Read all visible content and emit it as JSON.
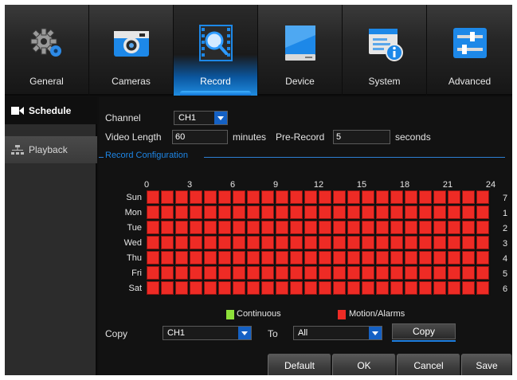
{
  "tabs": [
    {
      "label": "General",
      "icon": "gear-icon",
      "active": false
    },
    {
      "label": "Cameras",
      "icon": "camera-icon",
      "active": false
    },
    {
      "label": "Record",
      "icon": "record-search-icon",
      "active": true
    },
    {
      "label": "Device",
      "icon": "hard-drive-icon",
      "active": false
    },
    {
      "label": "System",
      "icon": "system-info-icon",
      "active": false
    },
    {
      "label": "Advanced",
      "icon": "sliders-icon",
      "active": false
    }
  ],
  "sidebar": {
    "items": [
      {
        "label": "Schedule",
        "icon": "video-camera-icon",
        "active": true
      },
      {
        "label": "Playback",
        "icon": "network-icon",
        "active": false
      }
    ]
  },
  "form": {
    "channel_label": "Channel",
    "channel_value": "CH1",
    "video_length_label": "Video Length",
    "video_length_value": "60",
    "minutes_label": "minutes",
    "prerecord_label": "Pre-Record",
    "prerecord_value": "5",
    "seconds_label": "seconds"
  },
  "section_title": "Record Configuration",
  "schedule": {
    "hour_labels": [
      "0",
      "3",
      "6",
      "9",
      "12",
      "15",
      "18",
      "21",
      "24"
    ],
    "days": [
      "Sun",
      "Mon",
      "Tue",
      "Wed",
      "Thu",
      "Fri",
      "Sat"
    ],
    "row_numbers": [
      "7",
      "1",
      "2",
      "3",
      "4",
      "5",
      "6"
    ],
    "cells_per_day": 24,
    "mode": "Motion/Alarms"
  },
  "legend": {
    "continuous_label": "Continuous",
    "continuous_color": "#8ee03a",
    "motion_label": "Motion/Alarms",
    "motion_color": "#ee2b25"
  },
  "copy": {
    "copy_label": "Copy",
    "from_value": "CH1",
    "to_label": "To",
    "to_value": "All",
    "button_label": "Copy"
  },
  "buttons": {
    "default": "Default",
    "ok": "OK",
    "cancel": "Cancel",
    "save": "Save"
  },
  "colors": {
    "accent": "#1e86e6",
    "record_red": "#ee2b25"
  }
}
